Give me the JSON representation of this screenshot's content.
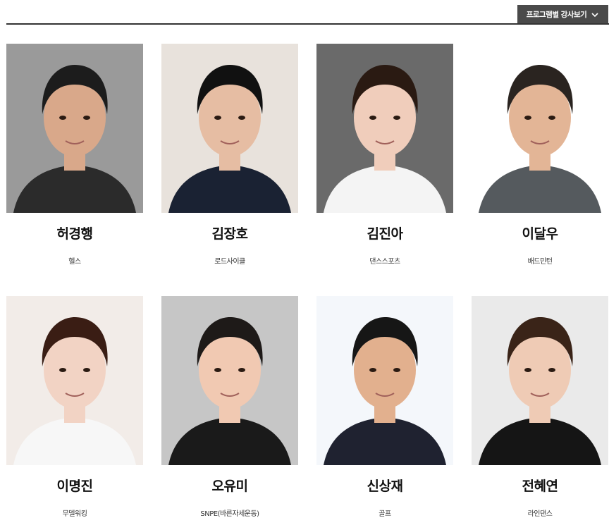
{
  "filter_button": {
    "label": "프로그램별 강사보기"
  },
  "instructors": [
    {
      "name": "허경행",
      "category": "헬스",
      "bg": "#9a9a9a",
      "hair": "#1c1c1c",
      "skin": "#d9a88a",
      "shirt": "#2b2b2b"
    },
    {
      "name": "김장호",
      "category": "로드사이클",
      "bg": "#e8e2dc",
      "hair": "#111111",
      "skin": "#e6bda3",
      "shirt": "#1a2233"
    },
    {
      "name": "김진아",
      "category": "댄스스포츠",
      "bg": "#6a6a6a",
      "hair": "#2a1a12",
      "skin": "#f0cdbb",
      "shirt": "#f4f4f4"
    },
    {
      "name": "이달우",
      "category": "배드민턴",
      "bg": "#ffffff",
      "hair": "#2a2420",
      "skin": "#e3b596",
      "shirt": "#555a5e"
    },
    {
      "name": "이명진",
      "category": "무델워킹",
      "bg": "#f2ece8",
      "hair": "#3a1d14",
      "skin": "#f2d3c4",
      "shirt": "#f7f7f7"
    },
    {
      "name": "오유미",
      "category": "SNPE(바른자세운동)",
      "bg": "#c6c6c6",
      "hair": "#1e1a18",
      "skin": "#f1c9b2",
      "shirt": "#1a1a1a"
    },
    {
      "name": "신상재",
      "category": "골프",
      "bg": "#f4f7fb",
      "hair": "#161616",
      "skin": "#e2b08e",
      "shirt": "#1f2230"
    },
    {
      "name": "전혜연",
      "category": "라인댄스",
      "bg": "#eaeaea",
      "hair": "#3a2418",
      "skin": "#efcbb5",
      "shirt": "#151515"
    }
  ]
}
